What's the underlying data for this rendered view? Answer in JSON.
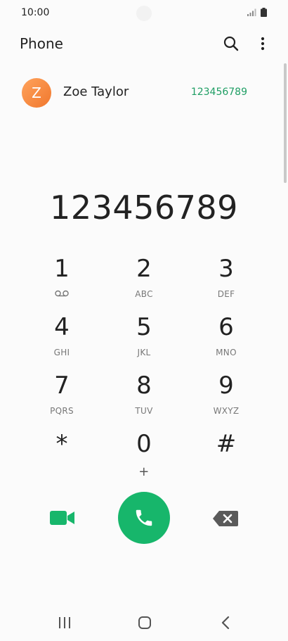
{
  "status_bar": {
    "time": "10:00",
    "icons": [
      "signal-icon",
      "battery-icon"
    ]
  },
  "header": {
    "title": "Phone",
    "actions": [
      "search-icon",
      "more-options-icon"
    ]
  },
  "suggested_contact": {
    "initial": "Z",
    "name": "Zoe Taylor",
    "number": "123456789"
  },
  "dialer": {
    "entered_number": "123456789"
  },
  "keypad": {
    "keys": [
      {
        "digit": "1",
        "letters": "",
        "icon": "voicemail-icon"
      },
      {
        "digit": "2",
        "letters": "ABC"
      },
      {
        "digit": "3",
        "letters": "DEF"
      },
      {
        "digit": "4",
        "letters": "GHI"
      },
      {
        "digit": "5",
        "letters": "JKL"
      },
      {
        "digit": "6",
        "letters": "MNO"
      },
      {
        "digit": "7",
        "letters": "PQRS"
      },
      {
        "digit": "8",
        "letters": "TUV"
      },
      {
        "digit": "9",
        "letters": "WXYZ"
      },
      {
        "digit": "*",
        "letters": ""
      },
      {
        "digit": "0",
        "letters": "+"
      },
      {
        "digit": "#",
        "letters": ""
      }
    ]
  },
  "actions": {
    "video_call_icon": "video-camera-icon",
    "call_icon": "phone-icon",
    "delete_icon": "backspace-icon"
  },
  "nav": [
    "recent-apps-icon",
    "home-icon",
    "back-icon"
  ],
  "colors": {
    "accent_green": "#17b66b",
    "number_green": "#1f9e64",
    "avatar_orange": "#f0772d"
  }
}
